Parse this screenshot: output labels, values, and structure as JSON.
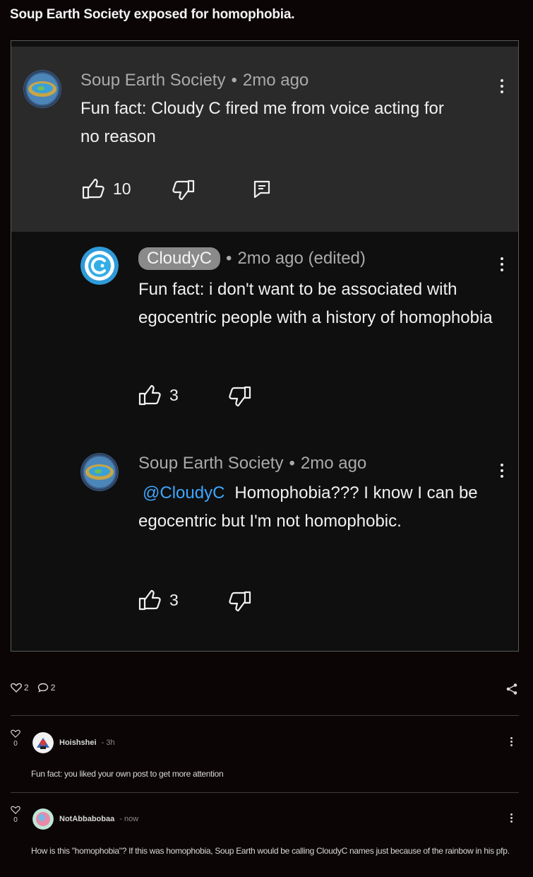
{
  "post": {
    "title": "Soup Earth Society exposed for homophobia.",
    "like_count": "2",
    "comment_count": "2"
  },
  "screenshot": {
    "comments": [
      {
        "author": "Soup Earth Society",
        "time": "2mo ago",
        "text": "Fun fact: Cloudy C fired me from voice acting for no reason",
        "likes": "10"
      },
      {
        "author": "CloudyC",
        "time": "2mo ago (edited)",
        "text": "Fun fact: i don't want to be associated with egocentric people with a history of homophobia",
        "likes": "3"
      },
      {
        "author": "Soup Earth Society",
        "time": "2mo ago",
        "mention": "@CloudyC",
        "text": "Homophobia??? I know I can be egocentric but I'm not homophobic.",
        "likes": "3"
      }
    ]
  },
  "feed_comments": [
    {
      "votes": "0",
      "author": "Hoishshei",
      "time": "3h",
      "text": "Fun fact: you liked your own post to get more attention"
    },
    {
      "votes": "0",
      "author": "NotAbbabobaa",
      "time": "now",
      "text": "How is this \"homophobia\"? If this was homophobia, Soup Earth would be calling CloudyC names just because of the rainbow in his pfp."
    }
  ],
  "icons": {
    "like": "thumbs-up-icon",
    "dislike": "thumbs-down-icon",
    "reply": "reply-icon",
    "more": "more-vertical-icon",
    "heart": "heart-icon",
    "comment": "comment-icon",
    "share": "share-icon"
  },
  "colors": {
    "background": "#0b0506",
    "top_comment_bg": "#2a2a2a",
    "reply_bg": "#0f0f0f",
    "mention": "#3ea6ff",
    "chip": "#8a8a8a"
  }
}
